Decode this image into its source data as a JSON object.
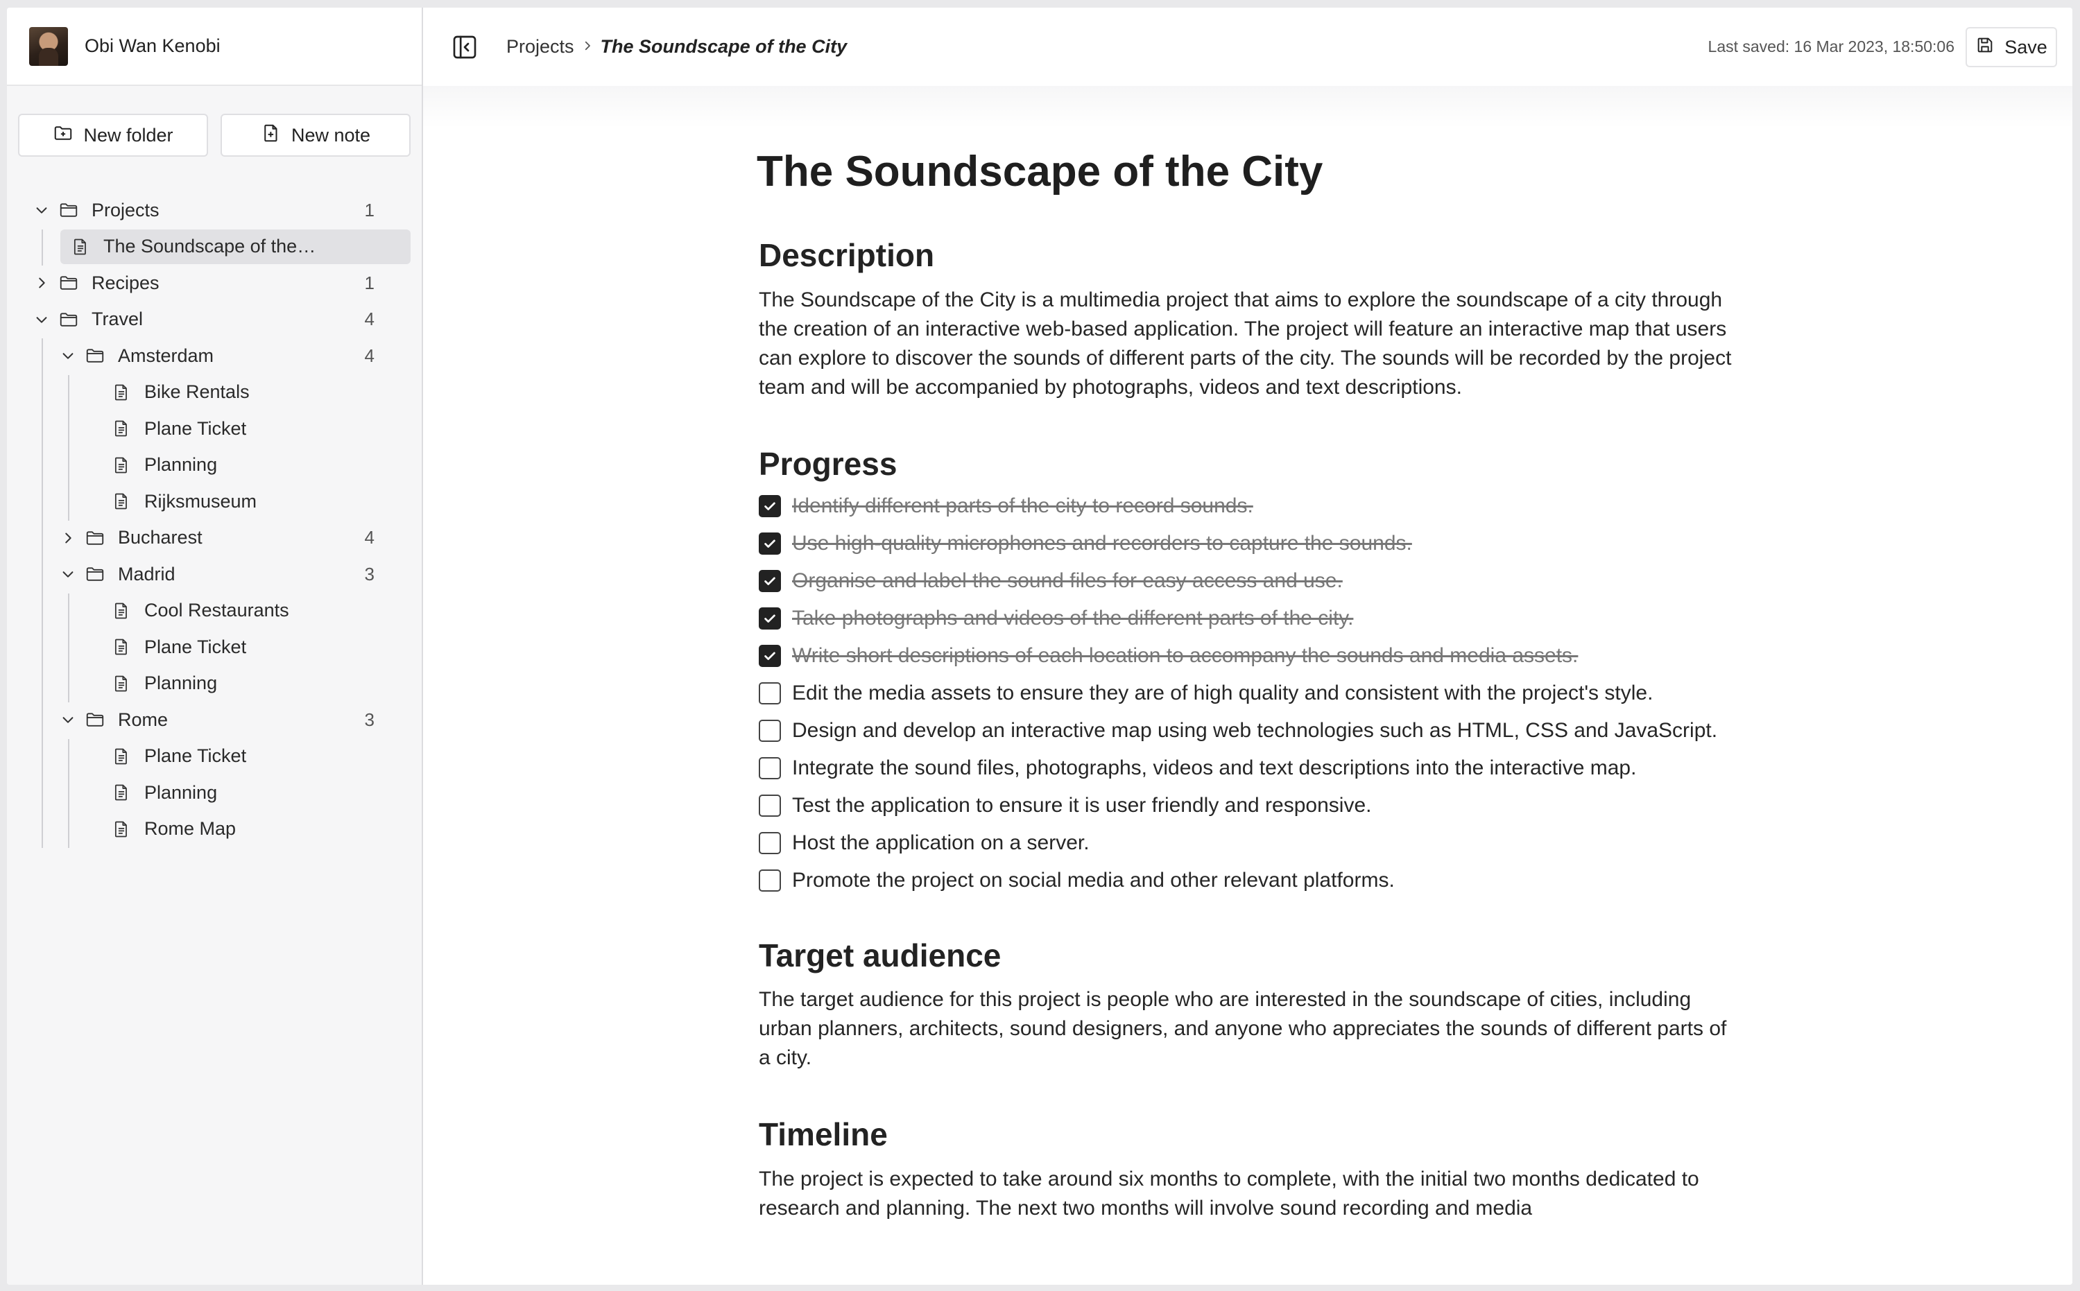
{
  "user": {
    "name": "Obi Wan Kenobi"
  },
  "actions": {
    "new_folder": "New folder",
    "new_note": "New note"
  },
  "tree": [
    {
      "label": "Projects",
      "type": "folder",
      "level": 0,
      "expanded": true,
      "count": "1"
    },
    {
      "label": "The Soundscape of the…",
      "type": "note",
      "level": 1,
      "selected": true
    },
    {
      "label": "Recipes",
      "type": "folder",
      "level": 0,
      "expanded": false,
      "count": "1"
    },
    {
      "label": "Travel",
      "type": "folder",
      "level": 0,
      "expanded": true,
      "count": "4"
    },
    {
      "label": "Amsterdam",
      "type": "folder",
      "level": 1,
      "expanded": true,
      "count": "4"
    },
    {
      "label": "Bike Rentals",
      "type": "note",
      "level": 2
    },
    {
      "label": "Plane Ticket",
      "type": "note",
      "level": 2
    },
    {
      "label": "Planning",
      "type": "note",
      "level": 2
    },
    {
      "label": "Rijksmuseum",
      "type": "note",
      "level": 2
    },
    {
      "label": "Bucharest",
      "type": "folder",
      "level": 1,
      "expanded": false,
      "count": "4"
    },
    {
      "label": "Madrid",
      "type": "folder",
      "level": 1,
      "expanded": true,
      "count": "3"
    },
    {
      "label": "Cool Restaurants",
      "type": "note",
      "level": 2
    },
    {
      "label": "Plane Ticket",
      "type": "note",
      "level": 2
    },
    {
      "label": "Planning",
      "type": "note",
      "level": 2
    },
    {
      "label": "Rome",
      "type": "folder",
      "level": 1,
      "expanded": true,
      "count": "3"
    },
    {
      "label": "Plane Ticket",
      "type": "note",
      "level": 2
    },
    {
      "label": "Planning",
      "type": "note",
      "level": 2
    },
    {
      "label": "Rome Map",
      "type": "note",
      "level": 2
    }
  ],
  "breadcrumb": {
    "parent": "Projects",
    "current": "The Soundscape of the City"
  },
  "status": {
    "last_saved": "Last saved: 16 Mar 2023, 18:50:06"
  },
  "toolbar": {
    "save_label": "Save"
  },
  "doc": {
    "title": "The Soundscape of the City",
    "description_heading": "Description",
    "description": "The Soundscape of the City is a multimedia project that aims to explore the soundscape of a city through the creation of an interactive web-based application. The project will feature an interactive map that users can explore to discover the sounds of different parts of the city. The sounds will be recorded by the project team and will be accompanied by photographs, videos and text descriptions.",
    "progress_heading": "Progress",
    "tasks": [
      {
        "text": "Identify different parts of the city to record sounds.",
        "done": true
      },
      {
        "text": "Use high-quality microphones and recorders to capture the sounds.",
        "done": true
      },
      {
        "text": "Organise and label the sound files for easy access and use.",
        "done": true
      },
      {
        "text": "Take photographs and videos of the different parts of the city.",
        "done": true
      },
      {
        "text": "Write short descriptions of each location to accompany the sounds and media assets.",
        "done": true
      },
      {
        "text": "Edit the media assets to ensure they are of high quality and consistent with the project's style.",
        "done": false
      },
      {
        "text": "Design and develop an interactive map using web technologies such as HTML, CSS and JavaScript.",
        "done": false
      },
      {
        "text": "Integrate the sound files, photographs, videos and text descriptions into the interactive map.",
        "done": false
      },
      {
        "text": "Test the application to ensure it is user friendly and responsive.",
        "done": false
      },
      {
        "text": "Host the application on a server.",
        "done": false
      },
      {
        "text": "Promote the project on social media and other relevant platforms.",
        "done": false
      }
    ],
    "audience_heading": "Target audience",
    "audience": "The target audience for this project is people who are interested in the soundscape of cities, including urban planners, architects, sound designers, and anyone who appreciates the sounds of different parts of a city.",
    "timeline_heading": "Timeline",
    "timeline": "The project is expected to take around six months to complete, with the initial two months dedicated to research and planning. The next two months will involve sound recording and media"
  }
}
